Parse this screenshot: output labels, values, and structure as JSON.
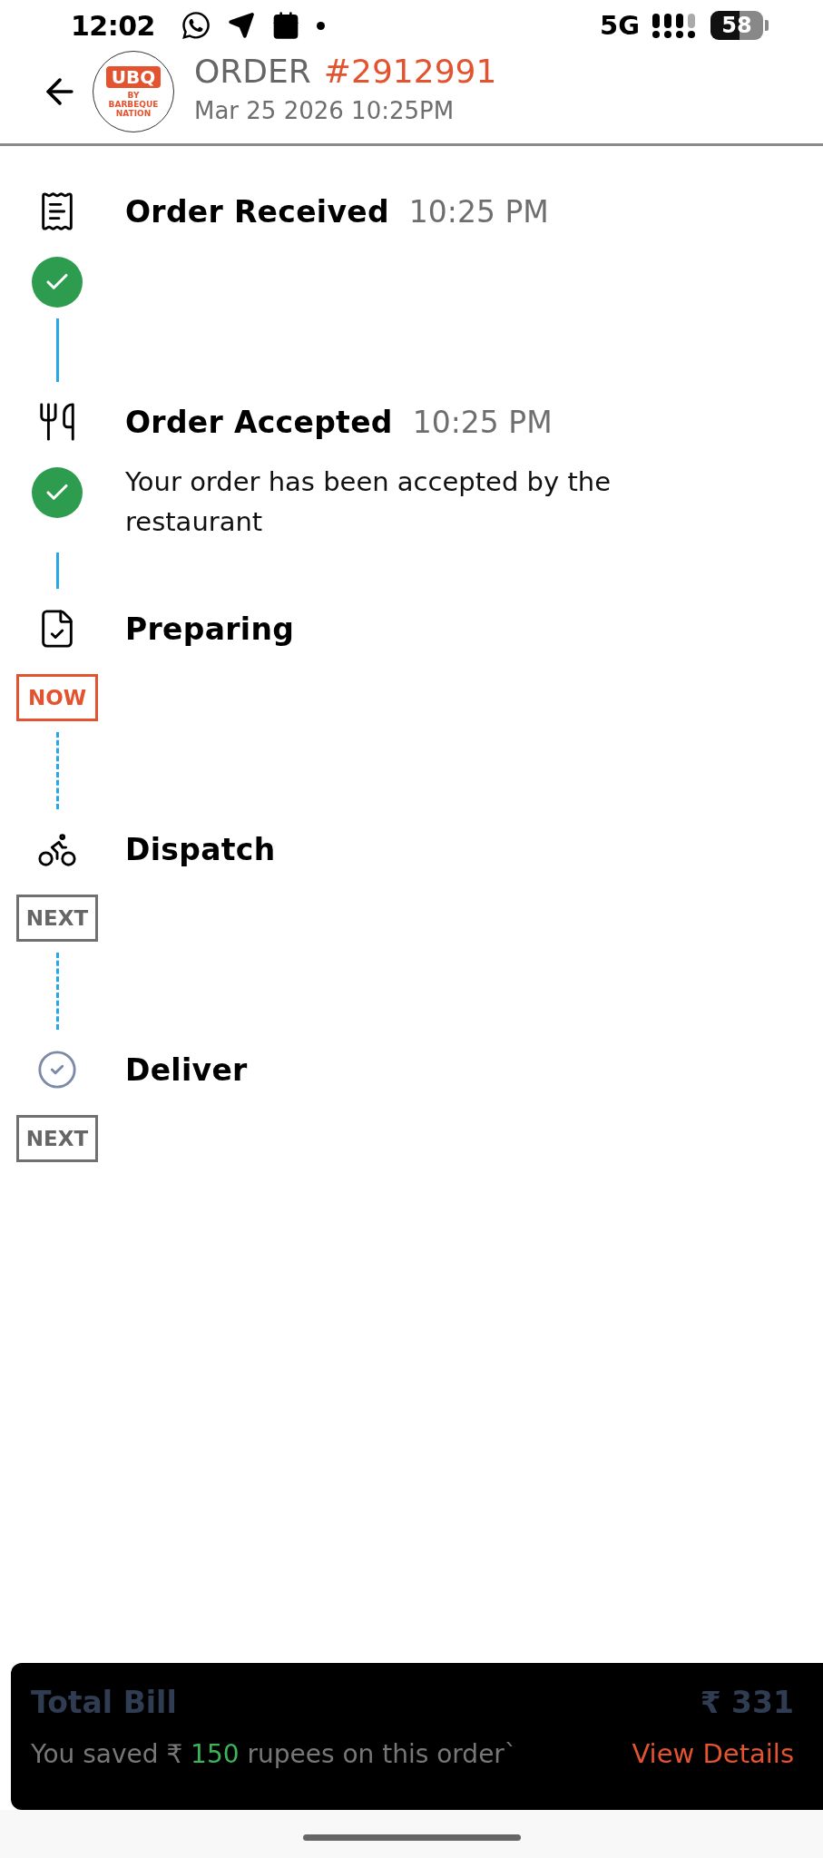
{
  "status_bar": {
    "time": "12:02",
    "network": "5G",
    "battery": "58"
  },
  "header": {
    "logo": {
      "mark": "UBQ",
      "tagline": "BY BARBEQUE NATION"
    },
    "title": "ORDER",
    "order_number": "#2912991",
    "date": "Mar 25 2026 10:25PM"
  },
  "steps": [
    {
      "title": "Order Received",
      "time": "10:25 PM",
      "completed": true
    },
    {
      "title": "Order Accepted",
      "time": "10:25 PM",
      "completed": true,
      "description": "Your order has been accepted by the restaurant"
    },
    {
      "title": "Preparing",
      "current": true,
      "badge": "NOW"
    },
    {
      "title": "Dispatch",
      "completed": false,
      "current": false,
      "badge": "NEXT"
    },
    {
      "title": "Deliver",
      "completed": false,
      "current": false,
      "badge": "NEXT"
    }
  ],
  "bill": {
    "label": "Total Bill",
    "amount": "₹ 331",
    "saved_before": "You saved ₹",
    "saved_amount": "150",
    "saved_after": "rupees on this order`",
    "link": "View Details"
  }
}
